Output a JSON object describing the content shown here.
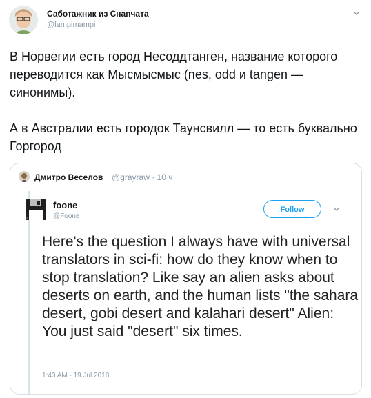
{
  "tweet": {
    "author_name": "Саботажник из Снапчата",
    "author_handle": "@lampimampi",
    "paragraph_1": "В Норвегии есть город Несоддтанген, название которого переводится как Мысмысмыс (nes, odd и tangen — синонимы).",
    "paragraph_2": "А в Австралии есть городок Таунсвилл — то есть буквально Горгород"
  },
  "quote": {
    "author_name": "Дмитро Веселов",
    "handle_time": "@grayraw · 10 ч",
    "embedded": {
      "author_name": "foone",
      "author_handle": "@Foone",
      "follow_label": "Follow",
      "text": "Here's the question I always have with universal translators in sci-fi: how do they know when to stop translation? Like say an alien asks about deserts on earth, and the human lists \"the sahara desert, gobi desert and kalahari desert\" Alien: You just said \"desert\" six times.",
      "timestamp": "1:43 AM - 19 Jul 2018"
    }
  },
  "colors": {
    "accent": "#1da1f2",
    "secondary_text": "#8899a6",
    "border": "#d7dde2"
  },
  "icons": [
    "avatar",
    "chevron-down-icon",
    "floppy-disk-avatar"
  ]
}
